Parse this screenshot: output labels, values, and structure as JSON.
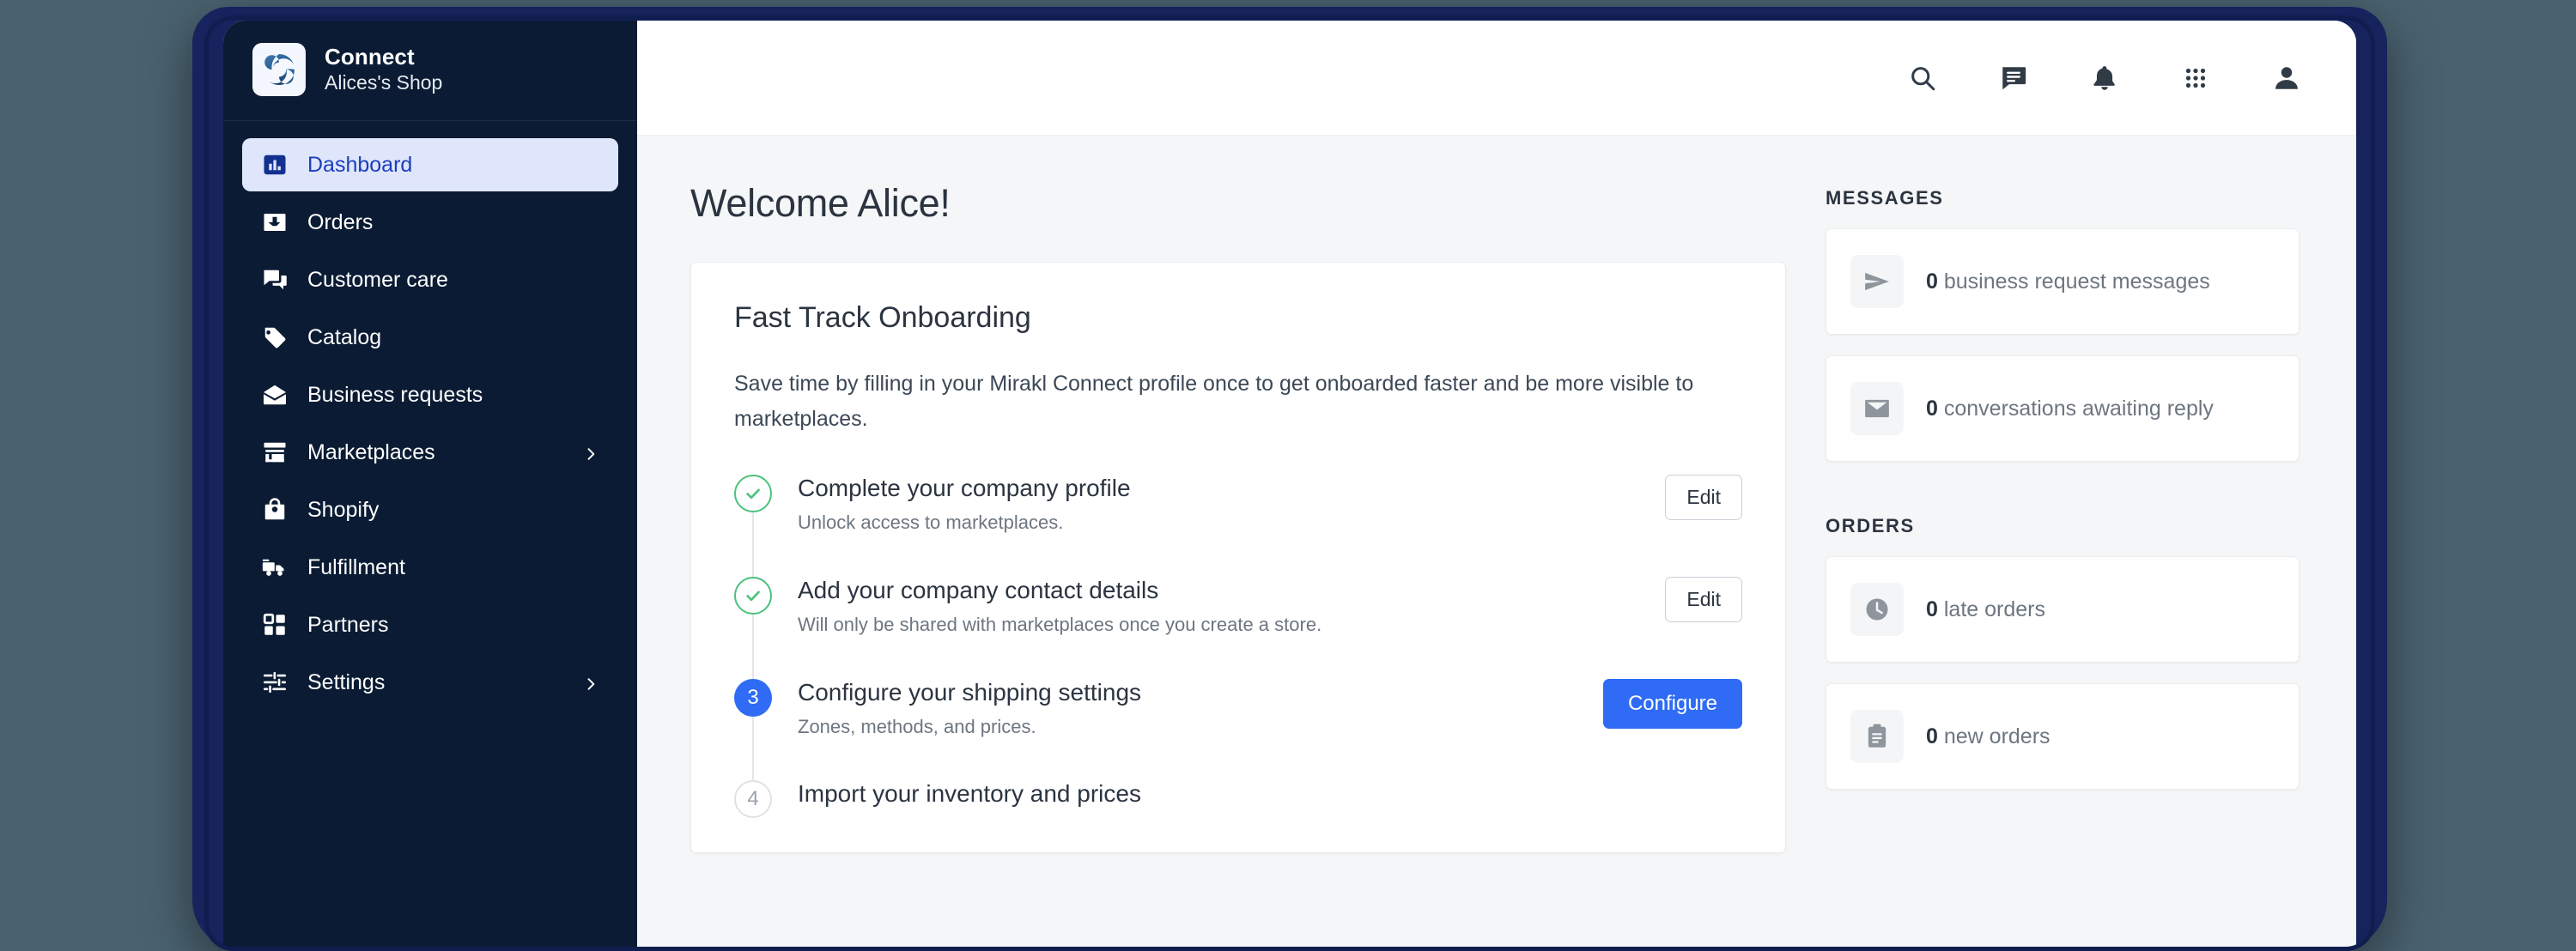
{
  "brand": {
    "logo_icon": "connect-swirl-logo",
    "title": "Connect",
    "subtitle": "Alices's Shop"
  },
  "sidebar": {
    "items": [
      {
        "label": "Dashboard",
        "icon": "bar-chart-icon",
        "active": true,
        "chevron": false
      },
      {
        "label": "Orders",
        "icon": "inbox-download-icon",
        "active": false,
        "chevron": false
      },
      {
        "label": "Customer care",
        "icon": "chat-bubbles-icon",
        "active": false,
        "chevron": false
      },
      {
        "label": "Catalog",
        "icon": "tag-icon",
        "active": false,
        "chevron": false
      },
      {
        "label": "Business requests",
        "icon": "open-envelope-icon",
        "active": false,
        "chevron": false
      },
      {
        "label": "Marketplaces",
        "icon": "storefront-icon",
        "active": false,
        "chevron": true
      },
      {
        "label": "Shopify",
        "icon": "shopping-bag-icon",
        "active": false,
        "chevron": false
      },
      {
        "label": "Fulfillment",
        "icon": "delivery-truck-icon",
        "active": false,
        "chevron": false
      },
      {
        "label": "Partners",
        "icon": "grid-blocks-icon",
        "active": false,
        "chevron": false
      },
      {
        "label": "Settings",
        "icon": "sliders-icon",
        "active": false,
        "chevron": true
      }
    ]
  },
  "topbar": {
    "icons": [
      {
        "name": "search-icon"
      },
      {
        "name": "chat-message-icon"
      },
      {
        "name": "bell-notification-icon"
      },
      {
        "name": "apps-grid-icon"
      },
      {
        "name": "user-account-icon"
      }
    ]
  },
  "main": {
    "page_title": "Welcome Alice!",
    "onboarding": {
      "title": "Fast Track Onboarding",
      "description": "Save time by filling in your Mirakl Connect profile once to get onboarded faster and be more visible to marketplaces.",
      "steps": [
        {
          "state": "done",
          "number": "1",
          "title": "Complete your company profile",
          "subtitle": "Unlock access to marketplaces.",
          "action_label": "Edit",
          "action_style": "secondary"
        },
        {
          "state": "done",
          "number": "2",
          "title": "Add your company contact details",
          "subtitle": "Will only be shared with marketplaces once you create a store.",
          "action_label": "Edit",
          "action_style": "secondary"
        },
        {
          "state": "current",
          "number": "3",
          "title": "Configure your shipping settings",
          "subtitle": "Zones, methods, and prices.",
          "action_label": "Configure",
          "action_style": "primary"
        },
        {
          "state": "todo",
          "number": "4",
          "title": "Import your inventory and prices",
          "subtitle": "",
          "action_label": "",
          "action_style": ""
        }
      ]
    }
  },
  "rail": {
    "messages_heading": "MESSAGES",
    "messages": [
      {
        "icon": "send-plane-icon",
        "count": "0",
        "label": "business request messages"
      },
      {
        "icon": "envelope-icon",
        "count": "0",
        "label": "conversations awaiting reply"
      }
    ],
    "orders_heading": "ORDERS",
    "orders": [
      {
        "icon": "clock-icon",
        "count": "0",
        "label": "late orders"
      },
      {
        "icon": "clipboard-icon",
        "count": "0",
        "label": "new orders"
      }
    ]
  },
  "colors": {
    "sidebar_bg": "#0a1b33",
    "accent_blue": "#2f6bf5",
    "active_nav_bg": "#dfe6fb",
    "active_nav_text": "#1c3ebd",
    "success_green": "#4cc27c",
    "page_bg": "#f5f6f7",
    "device_frame": "#16235c",
    "desktop_bg": "#4a6270"
  }
}
